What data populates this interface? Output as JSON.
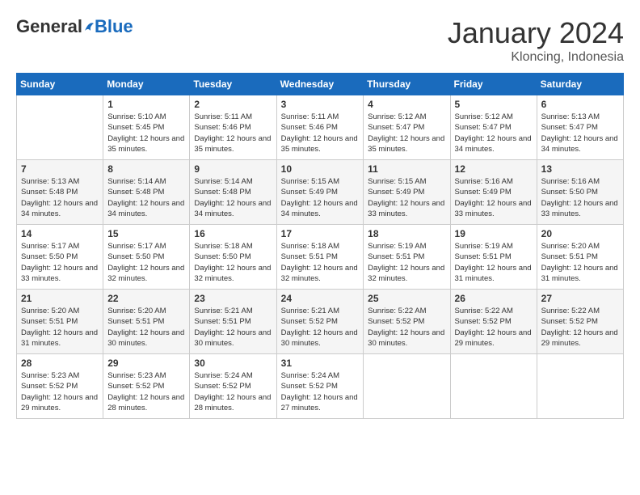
{
  "header": {
    "logo_general": "General",
    "logo_blue": "Blue",
    "month_title": "January 2024",
    "location": "Kloncing, Indonesia"
  },
  "calendar": {
    "days_of_week": [
      "Sunday",
      "Monday",
      "Tuesday",
      "Wednesday",
      "Thursday",
      "Friday",
      "Saturday"
    ],
    "weeks": [
      {
        "days": [
          {
            "number": "",
            "sunrise": "",
            "sunset": "",
            "daylight": ""
          },
          {
            "number": "1",
            "sunrise": "Sunrise: 5:10 AM",
            "sunset": "Sunset: 5:45 PM",
            "daylight": "Daylight: 12 hours and 35 minutes."
          },
          {
            "number": "2",
            "sunrise": "Sunrise: 5:11 AM",
            "sunset": "Sunset: 5:46 PM",
            "daylight": "Daylight: 12 hours and 35 minutes."
          },
          {
            "number": "3",
            "sunrise": "Sunrise: 5:11 AM",
            "sunset": "Sunset: 5:46 PM",
            "daylight": "Daylight: 12 hours and 35 minutes."
          },
          {
            "number": "4",
            "sunrise": "Sunrise: 5:12 AM",
            "sunset": "Sunset: 5:47 PM",
            "daylight": "Daylight: 12 hours and 35 minutes."
          },
          {
            "number": "5",
            "sunrise": "Sunrise: 5:12 AM",
            "sunset": "Sunset: 5:47 PM",
            "daylight": "Daylight: 12 hours and 34 minutes."
          },
          {
            "number": "6",
            "sunrise": "Sunrise: 5:13 AM",
            "sunset": "Sunset: 5:47 PM",
            "daylight": "Daylight: 12 hours and 34 minutes."
          }
        ]
      },
      {
        "days": [
          {
            "number": "7",
            "sunrise": "Sunrise: 5:13 AM",
            "sunset": "Sunset: 5:48 PM",
            "daylight": "Daylight: 12 hours and 34 minutes."
          },
          {
            "number": "8",
            "sunrise": "Sunrise: 5:14 AM",
            "sunset": "Sunset: 5:48 PM",
            "daylight": "Daylight: 12 hours and 34 minutes."
          },
          {
            "number": "9",
            "sunrise": "Sunrise: 5:14 AM",
            "sunset": "Sunset: 5:48 PM",
            "daylight": "Daylight: 12 hours and 34 minutes."
          },
          {
            "number": "10",
            "sunrise": "Sunrise: 5:15 AM",
            "sunset": "Sunset: 5:49 PM",
            "daylight": "Daylight: 12 hours and 34 minutes."
          },
          {
            "number": "11",
            "sunrise": "Sunrise: 5:15 AM",
            "sunset": "Sunset: 5:49 PM",
            "daylight": "Daylight: 12 hours and 33 minutes."
          },
          {
            "number": "12",
            "sunrise": "Sunrise: 5:16 AM",
            "sunset": "Sunset: 5:49 PM",
            "daylight": "Daylight: 12 hours and 33 minutes."
          },
          {
            "number": "13",
            "sunrise": "Sunrise: 5:16 AM",
            "sunset": "Sunset: 5:50 PM",
            "daylight": "Daylight: 12 hours and 33 minutes."
          }
        ]
      },
      {
        "days": [
          {
            "number": "14",
            "sunrise": "Sunrise: 5:17 AM",
            "sunset": "Sunset: 5:50 PM",
            "daylight": "Daylight: 12 hours and 33 minutes."
          },
          {
            "number": "15",
            "sunrise": "Sunrise: 5:17 AM",
            "sunset": "Sunset: 5:50 PM",
            "daylight": "Daylight: 12 hours and 32 minutes."
          },
          {
            "number": "16",
            "sunrise": "Sunrise: 5:18 AM",
            "sunset": "Sunset: 5:50 PM",
            "daylight": "Daylight: 12 hours and 32 minutes."
          },
          {
            "number": "17",
            "sunrise": "Sunrise: 5:18 AM",
            "sunset": "Sunset: 5:51 PM",
            "daylight": "Daylight: 12 hours and 32 minutes."
          },
          {
            "number": "18",
            "sunrise": "Sunrise: 5:19 AM",
            "sunset": "Sunset: 5:51 PM",
            "daylight": "Daylight: 12 hours and 32 minutes."
          },
          {
            "number": "19",
            "sunrise": "Sunrise: 5:19 AM",
            "sunset": "Sunset: 5:51 PM",
            "daylight": "Daylight: 12 hours and 31 minutes."
          },
          {
            "number": "20",
            "sunrise": "Sunrise: 5:20 AM",
            "sunset": "Sunset: 5:51 PM",
            "daylight": "Daylight: 12 hours and 31 minutes."
          }
        ]
      },
      {
        "days": [
          {
            "number": "21",
            "sunrise": "Sunrise: 5:20 AM",
            "sunset": "Sunset: 5:51 PM",
            "daylight": "Daylight: 12 hours and 31 minutes."
          },
          {
            "number": "22",
            "sunrise": "Sunrise: 5:20 AM",
            "sunset": "Sunset: 5:51 PM",
            "daylight": "Daylight: 12 hours and 30 minutes."
          },
          {
            "number": "23",
            "sunrise": "Sunrise: 5:21 AM",
            "sunset": "Sunset: 5:51 PM",
            "daylight": "Daylight: 12 hours and 30 minutes."
          },
          {
            "number": "24",
            "sunrise": "Sunrise: 5:21 AM",
            "sunset": "Sunset: 5:52 PM",
            "daylight": "Daylight: 12 hours and 30 minutes."
          },
          {
            "number": "25",
            "sunrise": "Sunrise: 5:22 AM",
            "sunset": "Sunset: 5:52 PM",
            "daylight": "Daylight: 12 hours and 30 minutes."
          },
          {
            "number": "26",
            "sunrise": "Sunrise: 5:22 AM",
            "sunset": "Sunset: 5:52 PM",
            "daylight": "Daylight: 12 hours and 29 minutes."
          },
          {
            "number": "27",
            "sunrise": "Sunrise: 5:22 AM",
            "sunset": "Sunset: 5:52 PM",
            "daylight": "Daylight: 12 hours and 29 minutes."
          }
        ]
      },
      {
        "days": [
          {
            "number": "28",
            "sunrise": "Sunrise: 5:23 AM",
            "sunset": "Sunset: 5:52 PM",
            "daylight": "Daylight: 12 hours and 29 minutes."
          },
          {
            "number": "29",
            "sunrise": "Sunrise: 5:23 AM",
            "sunset": "Sunset: 5:52 PM",
            "daylight": "Daylight: 12 hours and 28 minutes."
          },
          {
            "number": "30",
            "sunrise": "Sunrise: 5:24 AM",
            "sunset": "Sunset: 5:52 PM",
            "daylight": "Daylight: 12 hours and 28 minutes."
          },
          {
            "number": "31",
            "sunrise": "Sunrise: 5:24 AM",
            "sunset": "Sunset: 5:52 PM",
            "daylight": "Daylight: 12 hours and 27 minutes."
          },
          {
            "number": "",
            "sunrise": "",
            "sunset": "",
            "daylight": ""
          },
          {
            "number": "",
            "sunrise": "",
            "sunset": "",
            "daylight": ""
          },
          {
            "number": "",
            "sunrise": "",
            "sunset": "",
            "daylight": ""
          }
        ]
      }
    ]
  }
}
